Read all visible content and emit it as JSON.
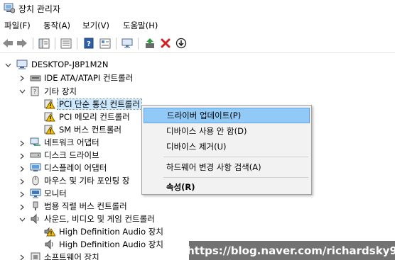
{
  "window": {
    "title": "장치 관리자"
  },
  "menubar": [
    {
      "label": "파일(F)"
    },
    {
      "label": "동작(A)"
    },
    {
      "label": "보기(V)"
    },
    {
      "label": "도움말(H)"
    }
  ],
  "toolbar": {
    "buttons": [
      {
        "icon": "back-arrow-icon"
      },
      {
        "icon": "forward-arrow-icon"
      },
      {
        "icon": "show-hide-tree-icon"
      },
      {
        "icon": "properties-icon"
      },
      {
        "icon": "help-icon"
      },
      {
        "icon": "view-icon"
      },
      {
        "icon": "scan-hardware-icon"
      },
      {
        "icon": "update-driver-icon"
      },
      {
        "icon": "uninstall-icon"
      },
      {
        "icon": "disable-device-icon"
      }
    ]
  },
  "tree": {
    "root": "DESKTOP-J8P1M2N",
    "items": [
      {
        "label": "IDE ATA/ATAPI 컨트롤러",
        "expanded": false,
        "icon": "ide-controller-icon"
      },
      {
        "label": "기타 장치",
        "expanded": true,
        "icon": "other-devices-icon"
      },
      {
        "label": "PCI 단순 통신 컨트롤러",
        "child": true,
        "warning": true,
        "selected": true
      },
      {
        "label": "PCI 메모리 컨트롤러",
        "child": true,
        "warning": true
      },
      {
        "label": "SM 버스 컨트롤러",
        "child": true,
        "warning": true
      },
      {
        "label": "네트워크 어댑터",
        "expanded": false,
        "icon": "network-adapter-icon"
      },
      {
        "label": "디스크 드라이브",
        "expanded": false,
        "icon": "disk-drive-icon"
      },
      {
        "label": "디스플레이 어댑터",
        "expanded": false,
        "icon": "display-adapter-icon"
      },
      {
        "label": "마우스 및 기타 포인팅 장",
        "expanded": false,
        "icon": "mouse-icon"
      },
      {
        "label": "모니터",
        "expanded": false,
        "icon": "monitor-icon"
      },
      {
        "label": "범용 직렬 버스 컨트롤러",
        "expanded": false,
        "icon": "usb-controller-icon"
      },
      {
        "label": "사운드, 비디오 및 게임 컨트롤러",
        "expanded": true,
        "icon": "sound-icon"
      },
      {
        "label": "High Definition Audio 장치",
        "child": true,
        "warning": true
      },
      {
        "label": "High Definition Audio 장치",
        "child": true,
        "icon": "speaker-icon"
      },
      {
        "label": "소프트웨어 장치",
        "expanded": false,
        "icon": "software-device-icon"
      }
    ]
  },
  "context_menu": {
    "items": [
      {
        "label": "드라이버 업데이트(P)",
        "highlighted": true
      },
      {
        "label": "디바이스 사용 안 함(D)"
      },
      {
        "label": "디바이스 제거(U)"
      },
      {
        "label": "하드웨어 변경 사항 검색(A)"
      },
      {
        "label": "속성(R)",
        "bold": true
      }
    ]
  },
  "watermark": {
    "text": "https://blog.naver.com/richardsky9"
  },
  "colors": {
    "selection": "#cce8ff",
    "menu_highlight": "#91c9f7",
    "menu_bg": "#f2f2f2",
    "warning": "#e8a000"
  }
}
